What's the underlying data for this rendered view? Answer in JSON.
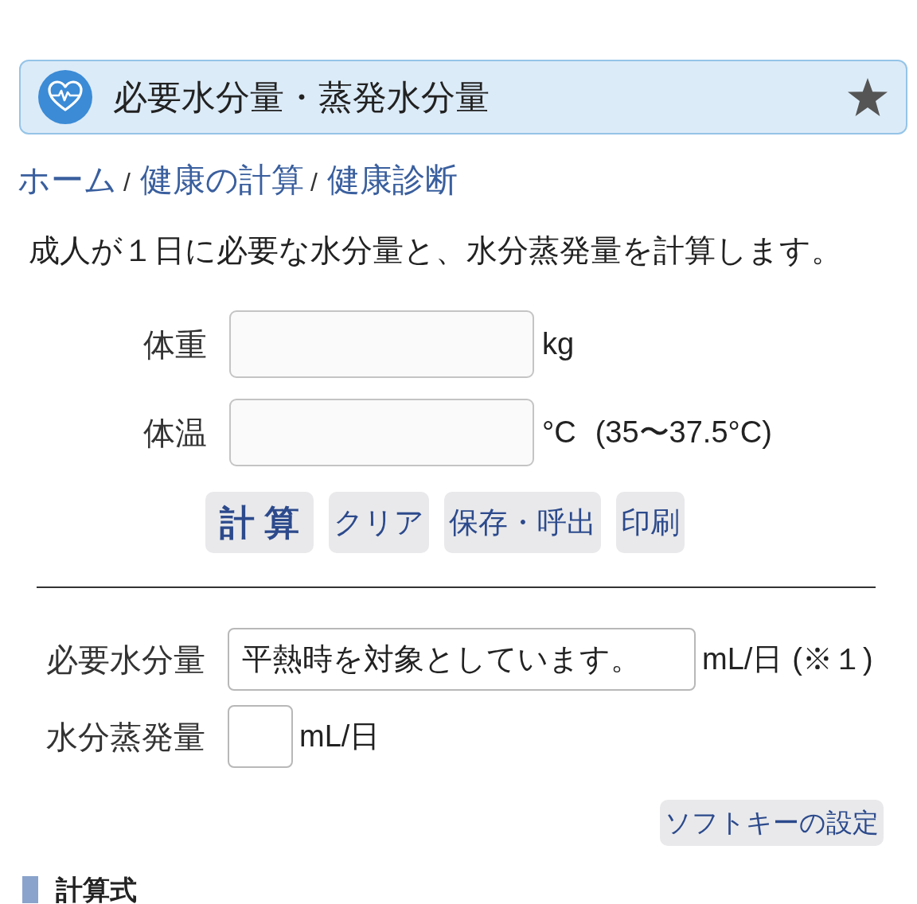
{
  "header": {
    "title": "必要水分量・蒸発水分量"
  },
  "breadcrumb": [
    {
      "kind": "link",
      "text": "ホーム"
    },
    {
      "kind": "separator",
      "text": "/"
    },
    {
      "kind": "link",
      "text": "健康の計算"
    },
    {
      "kind": "separator",
      "text": "/"
    },
    {
      "kind": "link",
      "text": "健康診断"
    }
  ],
  "description": "成人が１日に必要な水分量と、水分蒸発量を計算します。",
  "inputs": [
    {
      "label": "体重",
      "unit": "kg"
    },
    {
      "label": "体温",
      "unit": "°C",
      "note": "(35〜37.5°C)"
    }
  ],
  "buttons": [
    {
      "kind": "main",
      "label": "計 算"
    },
    {
      "kind": "plain",
      "label": "クリア"
    },
    {
      "kind": "plain",
      "label": "保存・呼出"
    },
    {
      "kind": "plain",
      "label": "印刷"
    }
  ],
  "results": [
    {
      "label": "必要水分量",
      "value": "平熱時を対象としています。",
      "unit": "mL/日",
      "note": "(※１)"
    },
    {
      "label": "水分蒸発量",
      "unit": "mL/日"
    }
  ],
  "softkey_button": "ソフトキーの設定",
  "section_heading": "計算式"
}
